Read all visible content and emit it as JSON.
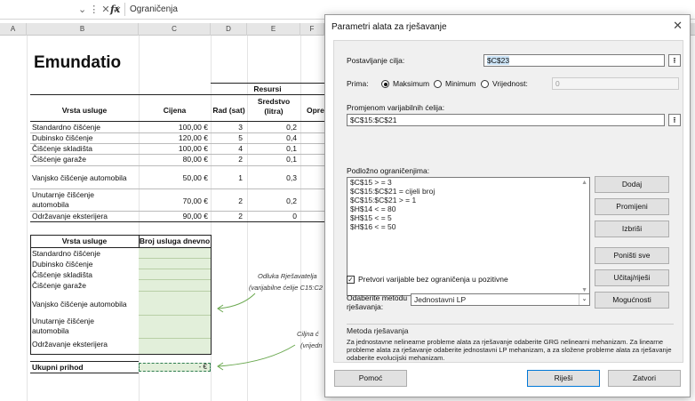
{
  "formula_bar": {
    "controls": "⌄ ⋮ ✕ ✓",
    "fx": "fx",
    "formula": "Ograničenja"
  },
  "columns": [
    "A",
    "B",
    "C",
    "D",
    "E",
    "F"
  ],
  "sheet": {
    "brand": "Emundatio",
    "resursi_header": "Resursi",
    "table1_headers": {
      "service": "Vrsta usluge",
      "price": "Cijena",
      "labor": "Rad (sat)",
      "agent": "Sredstvo (litra)",
      "equipment": "Opre"
    },
    "table1_rows": [
      {
        "service": "Standardno čišćenje",
        "price": "100,00 €",
        "labor": "3",
        "agent": "0,2"
      },
      {
        "service": "Dubinsko čišćenje",
        "price": "120,00 €",
        "labor": "5",
        "agent": "0,4"
      },
      {
        "service": "Čišćenje skladišta",
        "price": "100,00 €",
        "labor": "4",
        "agent": "0,1"
      },
      {
        "service": "Čišćenje garaže",
        "price": "80,00 €",
        "labor": "2",
        "agent": "0,1"
      },
      {
        "service": "Vanjsko čišćenje automobila",
        "price": "50,00 €",
        "labor": "1",
        "agent": "0,3"
      },
      {
        "service": "Unutarnje čišćenje automobila",
        "price": "70,00 €",
        "labor": "2",
        "agent": "0,2"
      },
      {
        "service": "Održavanje eksterijera",
        "price": "90,00 €",
        "labor": "2",
        "agent": "0"
      }
    ],
    "table2_headers": {
      "service": "Vrsta usluge",
      "count": "Broj usluga dnevno"
    },
    "table2_rows": [
      "Standardno čišćenje",
      "Dubinsko čišćenje",
      "Čišćenje skladišta",
      "Čišćenje garaže",
      "Vanjsko čišćenje automobila",
      "Unutarnje čišćenje automobila",
      "Održavanje eksterijera"
    ],
    "total_label": "Ukupni prihod",
    "total_value": "-   €",
    "note1_title": "Odluka Rješavatelja",
    "note1_sub": "(varijabilne ćelije C15:C2",
    "note2_title": "Ciljna ć",
    "note2_sub": "(vrijedn"
  },
  "dialog": {
    "title": "Parametri alata za rješavanje",
    "close": "✕",
    "objective_label": "Postavljanje cilja:",
    "objective_value": "$C$23",
    "to_label": "Prima:",
    "opt_max": "Maksimum",
    "opt_min": "Minimum",
    "opt_value": "Vrijednost:",
    "value_of": "0",
    "changing_label": "Promjenom varijabilnih ćelija:",
    "changing_value": "$C$15:$C$21",
    "constraints_label": "Podložno ograničenjima:",
    "constraints": [
      "$C$15 > = 3",
      "$C$15:$C$21 = cijeli broj",
      "$C$15:$C$21 > = 1",
      "$H$14 < = 80",
      "$H$15 < = 5",
      "$H$16 < = 50"
    ],
    "btn_add": "Dodaj",
    "btn_change": "Promijeni",
    "btn_delete": "Izbriši",
    "btn_reset": "Poništi sve",
    "btn_load": "Učitaj/riješi",
    "nonneg_label": "Pretvori varijable bez ograničenja u pozitivne",
    "method_label": "Odaberite metodu rješavanja:",
    "method_value": "Jednostavni LP",
    "btn_options": "Mogućnosti",
    "group_title": "Metoda rješavanja",
    "group_text": "Za jednostavne nelinearne probleme alata za rješavanje odaberite GRG nelinearni mehanizam. Za linearne probleme alata za rješavanje odaberite jednostavni LP mehanizam, a za složene probleme alata za rješavanje odaberite evolucijski mehanizam.",
    "btn_help": "Pomoć",
    "btn_solve": "Riješi",
    "btn_close": "Zatvori"
  }
}
